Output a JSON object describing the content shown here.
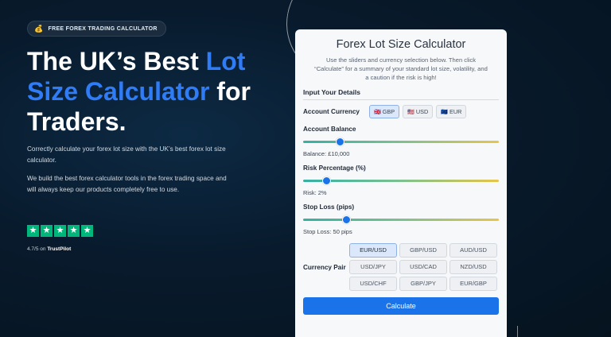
{
  "badge": {
    "icon": "money-bag-icon",
    "glyph": "💰",
    "text": "FREE FOREX TRADING CALCULATOR"
  },
  "hero": {
    "part1": "The UK’s Best ",
    "accent": "Lot Size Calculator",
    "part2": " for Traders.",
    "accent_color": "#2f7cf6"
  },
  "description": {
    "p1": "Correctly calculate your forex lot size with the UK’s best forex lot size calculator.",
    "p2": "We build the best forex calculator tools in the forex trading space and will always keep our products completely free to use."
  },
  "rating": {
    "stars": 5,
    "score": "4.7/5 on",
    "brand": "TrustPilot",
    "star_color": "#00b67a"
  },
  "calculator": {
    "title": "Forex Lot Size Calculator",
    "subtitle": "Use the sliders and currency selection below. Then click “Calculate” for a summary of your standard lot size, volatility, and a caution if the risk is high!",
    "section_title": "Input Your Details",
    "account_currency_label": "Account Currency",
    "currencies": [
      {
        "label": "GBP",
        "flag": "🇬🇧",
        "active": true
      },
      {
        "label": "USD",
        "flag": "🇺🇸",
        "active": false
      },
      {
        "label": "EUR",
        "flag": "🇪🇺",
        "active": false
      }
    ],
    "sliders": [
      {
        "label": "Account Balance",
        "value_text": "Balance: £10,000",
        "fraction": 0.19
      },
      {
        "label": "Risk Percentage (%)",
        "value_text": "Risk: 2%",
        "fraction": 0.12
      },
      {
        "label": "Stop Loss (pips)",
        "value_text": "Stop Loss: 50 pips",
        "fraction": 0.22
      }
    ],
    "currency_pair_label": "Currency Pair",
    "pairs": [
      {
        "label": "EUR/USD",
        "active": true
      },
      {
        "label": "GBP/USD",
        "active": false
      },
      {
        "label": "AUD/USD",
        "active": false
      },
      {
        "label": "USD/JPY",
        "active": false
      },
      {
        "label": "USD/CAD",
        "active": false
      },
      {
        "label": "NZD/USD",
        "active": false
      },
      {
        "label": "USD/CHF",
        "active": false
      },
      {
        "label": "GBP/JPY",
        "active": false
      },
      {
        "label": "EUR/GBP",
        "active": false
      }
    ],
    "calculate_label": "Calculate",
    "accent_color": "#1a73e8"
  }
}
